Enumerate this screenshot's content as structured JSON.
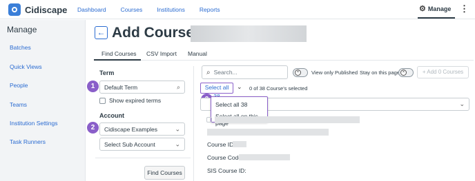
{
  "app": {
    "name": "Cidiscape"
  },
  "nav": {
    "links": [
      "Dashboard",
      "Courses",
      "Institutions",
      "Reports"
    ],
    "manage_label": "Manage"
  },
  "sidebar": {
    "title": "Manage",
    "items": [
      "Batches",
      "Quick Views",
      "People",
      "Teams",
      "Institution Settings",
      "Task Runners"
    ]
  },
  "header": {
    "title": "Add Courses:"
  },
  "tabs": [
    "Find Courses",
    "CSV Import",
    "Manual"
  ],
  "form": {
    "term_label": "Term",
    "term_value": "Default Term",
    "show_expired_label": "Show expired terms",
    "account_label": "Account",
    "account_value": "Cidiscape Examples",
    "sub_account_placeholder": "Select Sub Account",
    "find_button": "Find Courses"
  },
  "results": {
    "search_placeholder": "Search...",
    "view_only_published": "View only Published",
    "stay_on_page": "Stay on this page",
    "add_button": "+ Add 0 Courses",
    "select_all": "Select all 38",
    "selected_count": "0 of 38 Course's selected",
    "dropdown_options": [
      "Select all 38",
      "Select all on this page"
    ],
    "course_id_label": "Course ID:",
    "course_code_label": "Course Code:",
    "sis_course_id_label": "SIS Course ID:"
  },
  "badges": [
    "1",
    "2",
    "3"
  ],
  "colors": {
    "accent": "#2a6bd1",
    "badge": "#8a5fc9",
    "sidebar_bg": "#f2f4f6"
  }
}
